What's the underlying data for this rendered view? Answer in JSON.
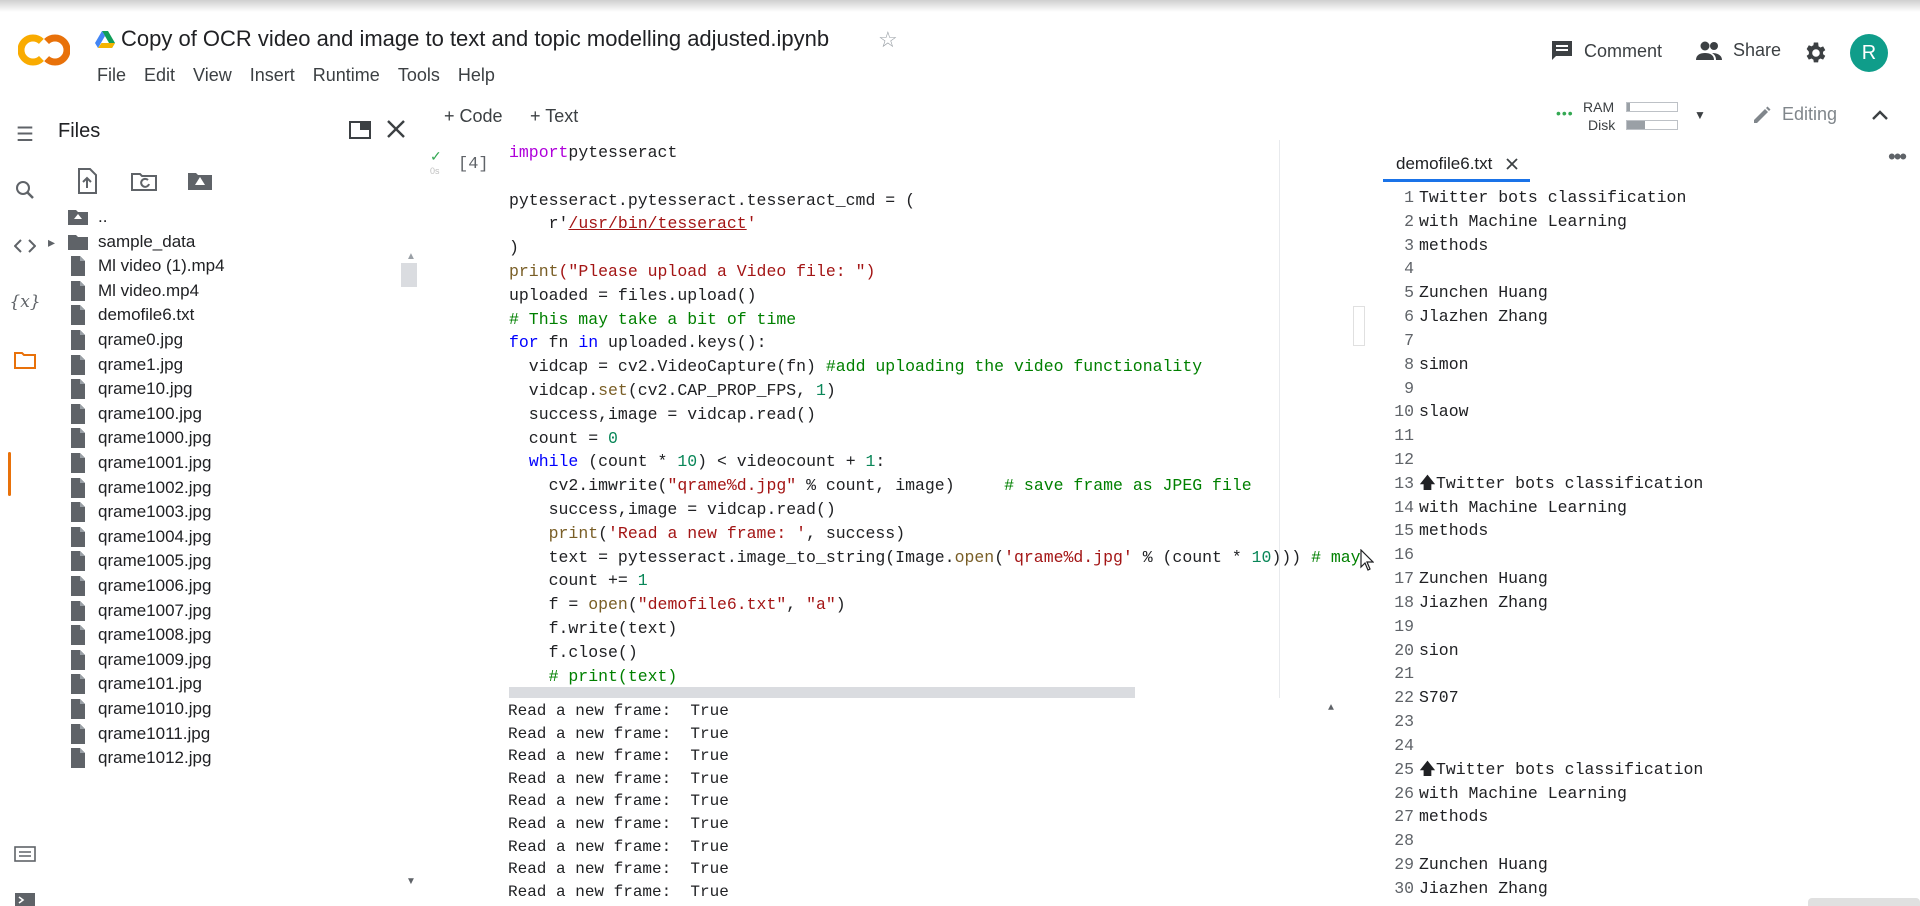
{
  "header": {
    "notebook_title": "Copy of OCR video and image to text and topic modelling adjusted.ipynb",
    "logo_text": "CO",
    "menu": [
      "File",
      "Edit",
      "View",
      "Insert",
      "Runtime",
      "Tools",
      "Help"
    ],
    "comment_label": "Comment",
    "share_label": "Share",
    "avatar_letter": "R",
    "colors": {
      "logo_orange": "#f9ab00",
      "logo_dark": "#e8710a",
      "avatar": "#0f9d8a",
      "accent": "#1a73e8"
    }
  },
  "rail": {
    "icons": [
      "table-of-contents-icon",
      "search-icon",
      "code-snippets-icon",
      "variables-icon",
      "files-icon"
    ],
    "bottom_icons": [
      "command-palette-icon",
      "terminal-icon"
    ]
  },
  "files": {
    "title": "Files",
    "tree": [
      {
        "name": "..",
        "type": "parent"
      },
      {
        "name": "sample_data",
        "type": "folder"
      },
      {
        "name": "Ml video (1).mp4",
        "type": "file"
      },
      {
        "name": "Ml video.mp4",
        "type": "file"
      },
      {
        "name": "demofile6.txt",
        "type": "file"
      },
      {
        "name": "qrame0.jpg",
        "type": "file"
      },
      {
        "name": "qrame1.jpg",
        "type": "file"
      },
      {
        "name": "qrame10.jpg",
        "type": "file"
      },
      {
        "name": "qrame100.jpg",
        "type": "file"
      },
      {
        "name": "qrame1000.jpg",
        "type": "file"
      },
      {
        "name": "qrame1001.jpg",
        "type": "file"
      },
      {
        "name": "qrame1002.jpg",
        "type": "file"
      },
      {
        "name": "qrame1003.jpg",
        "type": "file"
      },
      {
        "name": "qrame1004.jpg",
        "type": "file"
      },
      {
        "name": "qrame1005.jpg",
        "type": "file"
      },
      {
        "name": "qrame1006.jpg",
        "type": "file"
      },
      {
        "name": "qrame1007.jpg",
        "type": "file"
      },
      {
        "name": "qrame1008.jpg",
        "type": "file"
      },
      {
        "name": "qrame1009.jpg",
        "type": "file"
      },
      {
        "name": "qrame101.jpg",
        "type": "file"
      },
      {
        "name": "qrame1010.jpg",
        "type": "file"
      },
      {
        "name": "qrame1011.jpg",
        "type": "file"
      },
      {
        "name": "qrame1012.jpg",
        "type": "file"
      }
    ]
  },
  "toolbar": {
    "add_code_label": "+ Code",
    "add_text_label": "+ Text",
    "ram_label": "RAM",
    "disk_label": "Disk",
    "ram_usage": 0.05,
    "disk_usage": 0.35,
    "editing_label": "Editing"
  },
  "cell": {
    "execution_count": "[4]",
    "code": [
      [
        [
          "kw",
          "import"
        ],
        [
          "",
          "pytesseract"
        ]
      ],
      [],
      [
        [
          "",
          "pytesseract.pytesseract.tesseract_cmd = ("
        ]
      ],
      [
        [
          "",
          "    r'"
        ],
        [
          "str lnk",
          "/usr/bin/tesseract"
        ],
        [
          "str",
          "'"
        ]
      ],
      [
        [
          "",
          ")"
        ]
      ],
      [
        [
          "fn",
          "print"
        ],
        [
          "",
          ""
        ],
        [
          "str",
          "(\"Please upload a Video file: \")"
        ]
      ],
      [
        [
          "",
          "uploaded = files.upload()"
        ]
      ],
      [
        [
          "com",
          "# This may take a bit of time"
        ]
      ],
      [
        [
          "kwb",
          "for"
        ],
        [
          "",
          " fn "
        ],
        [
          "kwb",
          "in"
        ],
        [
          "",
          " uploaded.keys():"
        ]
      ],
      [
        [
          "",
          "  vidcap = cv2.VideoCapture(fn) "
        ],
        [
          "com",
          "#add uploading the video functionality"
        ]
      ],
      [
        [
          "",
          "  vidcap."
        ],
        [
          "fn",
          "set"
        ],
        [
          "",
          "(cv2.CAP_PROP_FPS, "
        ],
        [
          "num",
          "1"
        ],
        [
          "",
          ")"
        ]
      ],
      [
        [
          "",
          "  success,image = vidcap.read()"
        ]
      ],
      [
        [
          "",
          "  count = "
        ],
        [
          "num",
          "0"
        ]
      ],
      [
        [
          "",
          "  "
        ],
        [
          "kwb",
          "while"
        ],
        [
          "",
          " (count * "
        ],
        [
          "num",
          "10"
        ],
        [
          "",
          ") < videocount + "
        ],
        [
          "num",
          "1"
        ],
        [
          "",
          ":"
        ]
      ],
      [
        [
          "",
          "    cv2.imwrite("
        ],
        [
          "str",
          "\"qrame%d.jpg\""
        ],
        [
          "",
          " % count, image)     "
        ],
        [
          "com",
          "# save frame as JPEG file"
        ]
      ],
      [
        [
          "",
          "    success,image = vidcap.read()"
        ]
      ],
      [
        [
          "",
          "    "
        ],
        [
          "fn",
          "print"
        ],
        [
          "",
          "("
        ],
        [
          "str",
          "'Read a new frame: '"
        ],
        [
          "",
          ", success)"
        ]
      ],
      [
        [
          "",
          "    text = pytesseract.image_to_string(Image."
        ],
        [
          "fn",
          "open"
        ],
        [
          "",
          "("
        ],
        [
          "str",
          "'qrame%d.jpg'"
        ],
        [
          "",
          " % (count * "
        ],
        [
          "num",
          "10"
        ],
        [
          "",
          "))) "
        ],
        [
          "com",
          "# may"
        ]
      ],
      [
        [
          "",
          "    count += "
        ],
        [
          "num",
          "1"
        ]
      ],
      [
        [
          "",
          "    f = "
        ],
        [
          "fn",
          "open"
        ],
        [
          "",
          "("
        ],
        [
          "str",
          "\"demofile6.txt\""
        ],
        [
          "",
          ", "
        ],
        [
          "str",
          "\"a\""
        ],
        [
          "",
          ")"
        ]
      ],
      [
        [
          "",
          "    f.write(text)"
        ]
      ],
      [
        [
          "",
          "    f.close()"
        ]
      ],
      [
        [
          "com",
          "    # print(text)"
        ]
      ]
    ],
    "output": [
      "Read a new frame:  True",
      "Read a new frame:  True",
      "Read a new frame:  True",
      "Read a new frame:  True",
      "Read a new frame:  True",
      "Read a new frame:  True",
      "Read a new frame:  True",
      "Read a new frame:  True",
      "Read a new frame:  True"
    ]
  },
  "editor": {
    "tab_name": "demofile6.txt",
    "lines": [
      "Twitter bots classification",
      "with Machine Learning",
      "methods",
      "",
      "Zunchen Huang",
      "Jlazhen Zhang",
      "",
      "simon",
      "",
      "slaow",
      "",
      "",
      "🡅Twitter bots classification",
      "with Machine Learning",
      "methods",
      "",
      "Zunchen Huang",
      "Jiazhen Zhang",
      "",
      "sion",
      "",
      "S707",
      "",
      "",
      "🡅Twitter bots classification",
      "with Machine Learning",
      "methods",
      "",
      "Zunchen Huang",
      "Jiazhen Zhang"
    ]
  }
}
